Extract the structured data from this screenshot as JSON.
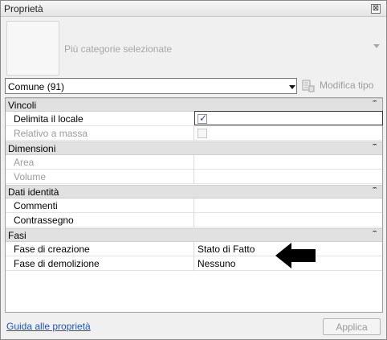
{
  "window": {
    "title": "Proprietà",
    "close_glyph": "⊠"
  },
  "type_selector": {
    "label": "Più categorie selezionate",
    "thumbnail_icon": "type-thumbnail",
    "arrow_icon": "dropdown-arrow"
  },
  "filter": {
    "value": "Comune (91)",
    "arrow_icon": "chevron-down"
  },
  "edit_type": {
    "label": "Modifica tipo",
    "icon": "edit-type-icon",
    "enabled": false
  },
  "grid": {
    "categories": [
      {
        "label": "Vincoli",
        "collapse_glyph": "ˆˆ",
        "rows": [
          {
            "name": "Delimita il locale",
            "type": "checkbox",
            "checked": true,
            "enabled": true
          },
          {
            "name": "Relativo a massa",
            "type": "checkbox",
            "checked": false,
            "enabled": false
          }
        ]
      },
      {
        "label": "Dimensioni",
        "collapse_glyph": "ˆˆ",
        "rows": [
          {
            "name": "Area",
            "value": "",
            "enabled": false
          },
          {
            "name": "Volume",
            "value": "",
            "enabled": false
          }
        ]
      },
      {
        "label": "Dati identità",
        "collapse_glyph": "ˆˆ",
        "rows": [
          {
            "name": "Commenti",
            "value": "",
            "enabled": true
          },
          {
            "name": "Contrassegno",
            "value": "",
            "enabled": true
          }
        ]
      },
      {
        "label": "Fasi",
        "collapse_glyph": "ˆˆ",
        "rows": [
          {
            "name": "Fase di creazione",
            "value": "Stato di Fatto",
            "enabled": true
          },
          {
            "name": "Fase di demolizione",
            "value": "Nessuno",
            "enabled": true
          }
        ]
      }
    ],
    "check_glyph": "✓"
  },
  "annotation": {
    "icon": "black-arrow-left",
    "color": "#000000"
  },
  "footer": {
    "help_link": "Guida alle proprietà",
    "apply_label": "Applica",
    "apply_enabled": false
  },
  "colors": {
    "category_bg": "#e1e1e1",
    "link": "#1a55c8",
    "disabled_text": "#9b9b9b"
  }
}
